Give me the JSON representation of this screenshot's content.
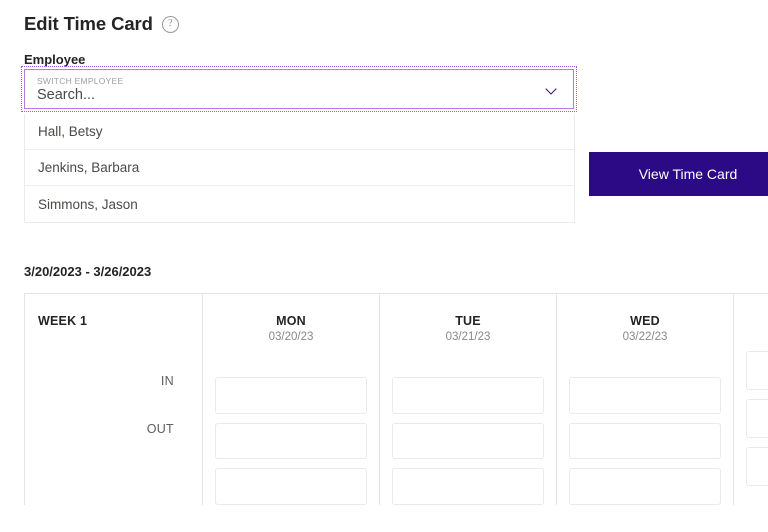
{
  "header": {
    "title": "Edit Time Card",
    "help_icon": "help-circle-icon",
    "help_glyph": "?"
  },
  "employee_section": {
    "label": "Employee",
    "combobox": {
      "caption": "SWITCH EMPLOYEE",
      "value": "Search...",
      "placeholder": "Search...",
      "chevron_icon": "chevron-down-icon",
      "focus_outline_color": "#a855e8",
      "border_color": "#b57ae0",
      "expanded": true
    },
    "dropdown_options": [
      "Hall, Betsy",
      "Jenkins, Barbara",
      "Simmons, Jason"
    ]
  },
  "actions": {
    "view_time_card_label": "View Time Card",
    "view_time_card_color": "#2d0a85"
  },
  "timecard": {
    "date_range": "3/20/2023 - 3/26/2023",
    "week_label": "WEEK 1",
    "row_labels": [
      "IN",
      "OUT"
    ],
    "days": [
      {
        "name": "MON",
        "date": "03/20/23"
      },
      {
        "name": "TUE",
        "date": "03/21/23"
      },
      {
        "name": "WED",
        "date": "03/22/23"
      },
      {
        "name": "",
        "date": ""
      }
    ],
    "cells": {
      "in": [
        "",
        "",
        "",
        ""
      ],
      "out": [
        "",
        "",
        "",
        ""
      ],
      "third": [
        "",
        "",
        "",
        ""
      ]
    },
    "picker_icon": "time-picker-icon"
  }
}
